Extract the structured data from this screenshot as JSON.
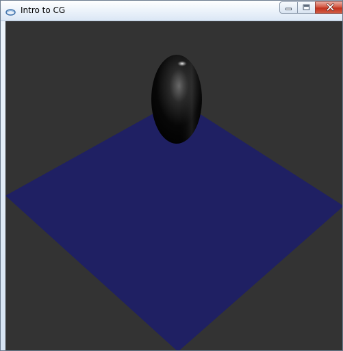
{
  "window": {
    "title": "Intro to CG",
    "icon": "app-icon",
    "controls": [
      "minimize-icon",
      "maximize-icon",
      "close-icon"
    ]
  },
  "scene": {
    "background_color": "#333333",
    "plane_color": "#1f2063",
    "object_color": "#000000"
  }
}
